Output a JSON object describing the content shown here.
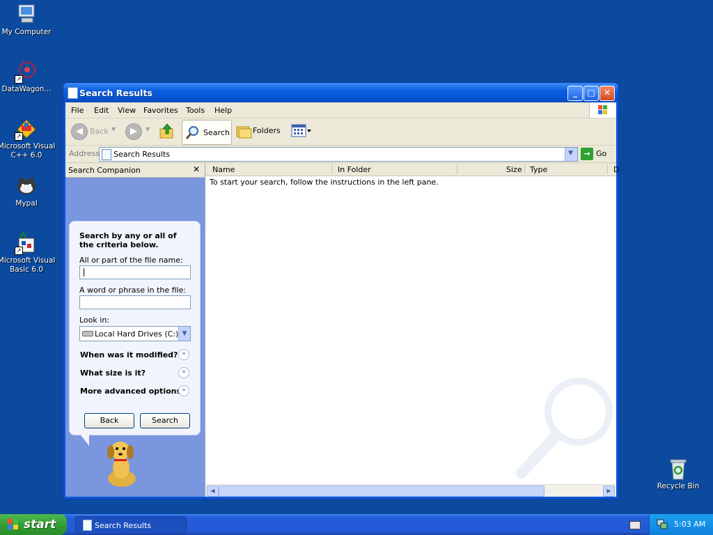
{
  "desktop": {
    "icons": [
      {
        "label": "My Computer",
        "icon": "computer-icon"
      },
      {
        "label": "DataWagon...",
        "icon": "datawagon-icon"
      },
      {
        "label": "Microsoft Visual C++ 6.0",
        "icon": "visual-cpp-icon"
      },
      {
        "label": "Mypal",
        "icon": "mypal-icon"
      },
      {
        "label": "Microsoft Visual Basic 6.0",
        "icon": "visual-basic-icon"
      },
      {
        "label": "Recycle Bin",
        "icon": "recycle-bin-icon"
      }
    ]
  },
  "window": {
    "title": "Search Results",
    "menu": [
      "File",
      "Edit",
      "View",
      "Favorites",
      "Tools",
      "Help"
    ],
    "toolbar": {
      "back": "Back",
      "search": "Search",
      "folders": "Folders"
    },
    "address": {
      "label": "Address",
      "value": "Search Results",
      "go": "Go"
    },
    "companion": {
      "title": "Search Companion",
      "close": "✕",
      "heading": "Search by any or all of the criteria below.",
      "filename_label": "All or part of the file name:",
      "filename_value": "",
      "phrase_label": "A word or phrase in the file:",
      "phrase_value": "",
      "lookin_label": "Look in:",
      "lookin_value": "Local Hard Drives (C:)",
      "options": [
        "When was it modified?",
        "What size is it?",
        "More advanced options"
      ],
      "back_button": "Back",
      "search_button": "Search"
    },
    "results": {
      "columns": [
        "Name",
        "In Folder",
        "Size",
        "Type",
        "D"
      ],
      "message": "To start your search, follow the instructions in the left pane."
    }
  },
  "taskbar": {
    "start": "start",
    "task": "Search Results",
    "time": "5:03 AM"
  }
}
